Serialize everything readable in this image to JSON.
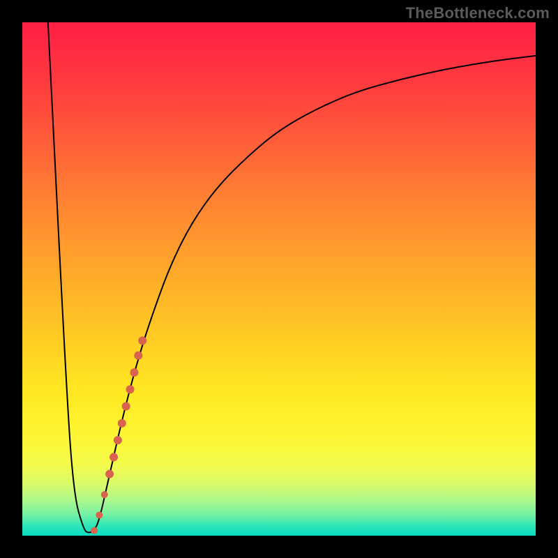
{
  "watermark": "TheBottleneck.com",
  "chart_data": {
    "type": "line",
    "title": "",
    "xlabel": "",
    "ylabel": "",
    "xlim": [
      0,
      100
    ],
    "ylim": [
      0,
      100
    ],
    "grid": false,
    "series": [
      {
        "name": "curve",
        "stroke": "#000000",
        "stroke_width": 2,
        "x": [
          5,
          8.5,
          10,
          12,
          13,
          14,
          15,
          17,
          20,
          23,
          26,
          29,
          33,
          38,
          44,
          50,
          57,
          65,
          74,
          83,
          92,
          100
        ],
        "y": [
          100,
          30,
          8,
          1,
          0.5,
          1,
          3,
          12,
          25,
          36,
          45,
          53,
          61,
          68,
          74,
          79,
          83,
          86.5,
          89,
          91,
          92.5,
          93.5
        ]
      }
    ],
    "markers": {
      "name": "highlight-dots",
      "color": "#d9634e",
      "shape": "circle",
      "points": [
        {
          "x": 14.0,
          "y": 1.0,
          "r": 5
        },
        {
          "x": 15.0,
          "y": 4.0,
          "r": 5
        },
        {
          "x": 16.0,
          "y": 8.0,
          "r": 5
        },
        {
          "x": 17.0,
          "y": 12.0,
          "r": 6
        },
        {
          "x": 17.8,
          "y": 15.3,
          "r": 6
        },
        {
          "x": 18.6,
          "y": 18.6,
          "r": 6
        },
        {
          "x": 19.4,
          "y": 21.9,
          "r": 6
        },
        {
          "x": 20.2,
          "y": 25.2,
          "r": 6
        },
        {
          "x": 21.0,
          "y": 28.5,
          "r": 6
        },
        {
          "x": 21.8,
          "y": 31.8,
          "r": 6
        },
        {
          "x": 22.6,
          "y": 35.1,
          "r": 6
        },
        {
          "x": 23.4,
          "y": 38.0,
          "r": 6
        }
      ]
    }
  }
}
